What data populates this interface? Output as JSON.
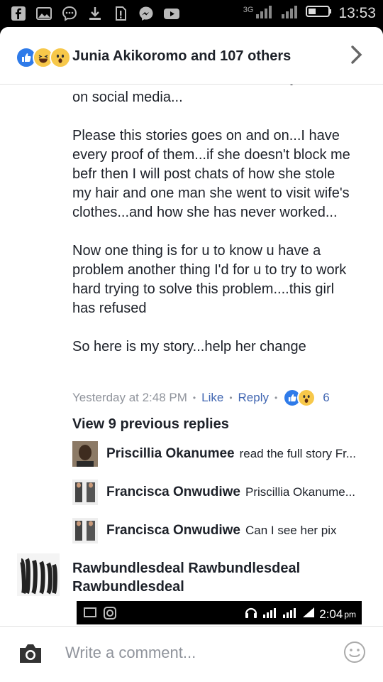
{
  "status_bar": {
    "network": "3G",
    "time": "13:53",
    "left_icons": [
      "facebook-icon",
      "image-icon",
      "chat-bubble-icon",
      "download-icon",
      "alert-icon",
      "messenger-icon",
      "youtube-icon"
    ]
  },
  "header": {
    "reactions": [
      "like",
      "haha",
      "wow"
    ],
    "title": "Junia Akikoromo and 107 others"
  },
  "post": {
    "paragraphs": [
      "well not to write fake stories about your self on social media...",
      "Please this stories goes on and on...I have every proof of them...if she doesn't block me befr then I will post chats of how she stole my hair and one man she went to visit wife's clothes...and how she has never worked...",
      "Now one thing is for u to know u have a problem another thing I'd for u to try to work hard trying to solve this problem....this girl has refused",
      "So here is my story...help her change"
    ],
    "meta": {
      "time": "Yesterday at 2:48 PM",
      "like": "Like",
      "reply": "Reply",
      "reaction_count": "6"
    }
  },
  "replies": {
    "view_previous": "View 9 previous replies",
    "items": [
      {
        "name": "Priscillia Okanumee",
        "text": "read the full story Fr..."
      },
      {
        "name": "Francisca Onwudiwe",
        "text": "Priscillia Okanume..."
      },
      {
        "name": "Francisca Onwudiwe",
        "text": "Can I see her pix"
      }
    ]
  },
  "comment2": {
    "name": "Rawbundlesdeal Rawbundlesdeal Rawbundlesdeal",
    "shot_time": "2:04",
    "shot_ampm": "pm"
  },
  "composer": {
    "placeholder": "Write a comment..."
  },
  "colors": {
    "link": "#4267b2",
    "like_blue": "#2f7be9",
    "muted": "#90949c",
    "text": "#1d2129"
  }
}
